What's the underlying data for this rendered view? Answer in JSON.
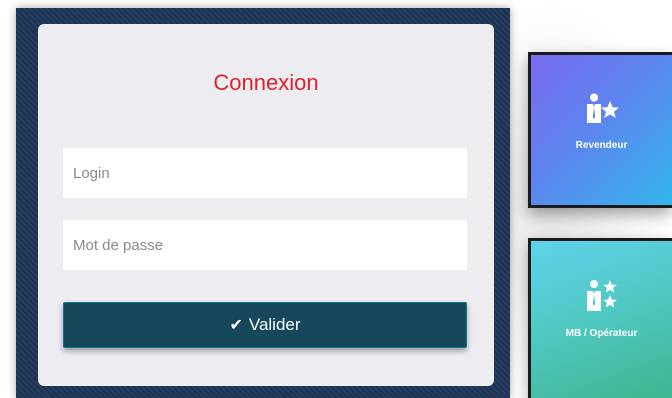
{
  "login": {
    "title": "Connexion",
    "login_placeholder": "Login",
    "login_value": "",
    "password_placeholder": "Mot de passe",
    "password_value": "",
    "submit_label": "Valider",
    "submit_icon": "check-icon"
  },
  "tiles": [
    {
      "label": "Revendeur",
      "icon": "reseller-star-icon"
    },
    {
      "label": "MB / Opérateur",
      "icon": "operator-stars-icon"
    }
  ],
  "colors": {
    "title": "#d9232e",
    "panel": "#1d3557",
    "card": "#ececf1",
    "button": "#16475a"
  }
}
